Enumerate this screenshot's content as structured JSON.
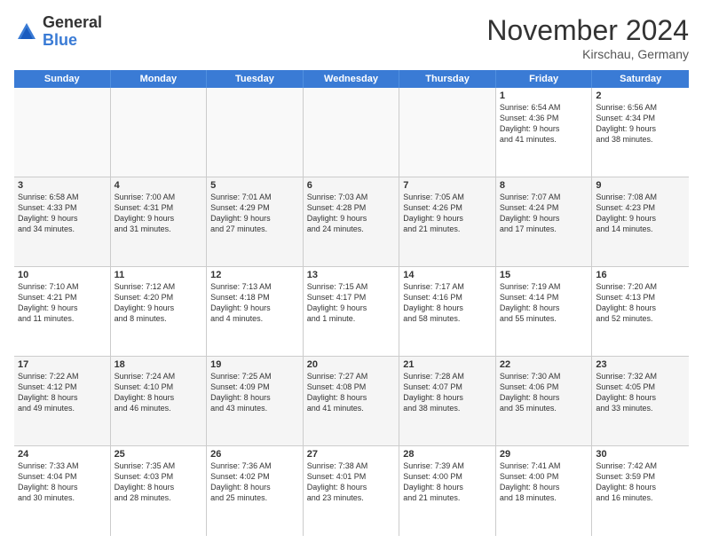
{
  "logo": {
    "general": "General",
    "blue": "Blue"
  },
  "header": {
    "month": "November 2024",
    "location": "Kirschau, Germany"
  },
  "weekdays": [
    "Sunday",
    "Monday",
    "Tuesday",
    "Wednesday",
    "Thursday",
    "Friday",
    "Saturday"
  ],
  "weeks": [
    [
      {
        "day": "",
        "info": ""
      },
      {
        "day": "",
        "info": ""
      },
      {
        "day": "",
        "info": ""
      },
      {
        "day": "",
        "info": ""
      },
      {
        "day": "",
        "info": ""
      },
      {
        "day": "1",
        "info": "Sunrise: 6:54 AM\nSunset: 4:36 PM\nDaylight: 9 hours\nand 41 minutes."
      },
      {
        "day": "2",
        "info": "Sunrise: 6:56 AM\nSunset: 4:34 PM\nDaylight: 9 hours\nand 38 minutes."
      }
    ],
    [
      {
        "day": "3",
        "info": "Sunrise: 6:58 AM\nSunset: 4:33 PM\nDaylight: 9 hours\nand 34 minutes."
      },
      {
        "day": "4",
        "info": "Sunrise: 7:00 AM\nSunset: 4:31 PM\nDaylight: 9 hours\nand 31 minutes."
      },
      {
        "day": "5",
        "info": "Sunrise: 7:01 AM\nSunset: 4:29 PM\nDaylight: 9 hours\nand 27 minutes."
      },
      {
        "day": "6",
        "info": "Sunrise: 7:03 AM\nSunset: 4:28 PM\nDaylight: 9 hours\nand 24 minutes."
      },
      {
        "day": "7",
        "info": "Sunrise: 7:05 AM\nSunset: 4:26 PM\nDaylight: 9 hours\nand 21 minutes."
      },
      {
        "day": "8",
        "info": "Sunrise: 7:07 AM\nSunset: 4:24 PM\nDaylight: 9 hours\nand 17 minutes."
      },
      {
        "day": "9",
        "info": "Sunrise: 7:08 AM\nSunset: 4:23 PM\nDaylight: 9 hours\nand 14 minutes."
      }
    ],
    [
      {
        "day": "10",
        "info": "Sunrise: 7:10 AM\nSunset: 4:21 PM\nDaylight: 9 hours\nand 11 minutes."
      },
      {
        "day": "11",
        "info": "Sunrise: 7:12 AM\nSunset: 4:20 PM\nDaylight: 9 hours\nand 8 minutes."
      },
      {
        "day": "12",
        "info": "Sunrise: 7:13 AM\nSunset: 4:18 PM\nDaylight: 9 hours\nand 4 minutes."
      },
      {
        "day": "13",
        "info": "Sunrise: 7:15 AM\nSunset: 4:17 PM\nDaylight: 9 hours\nand 1 minute."
      },
      {
        "day": "14",
        "info": "Sunrise: 7:17 AM\nSunset: 4:16 PM\nDaylight: 8 hours\nand 58 minutes."
      },
      {
        "day": "15",
        "info": "Sunrise: 7:19 AM\nSunset: 4:14 PM\nDaylight: 8 hours\nand 55 minutes."
      },
      {
        "day": "16",
        "info": "Sunrise: 7:20 AM\nSunset: 4:13 PM\nDaylight: 8 hours\nand 52 minutes."
      }
    ],
    [
      {
        "day": "17",
        "info": "Sunrise: 7:22 AM\nSunset: 4:12 PM\nDaylight: 8 hours\nand 49 minutes."
      },
      {
        "day": "18",
        "info": "Sunrise: 7:24 AM\nSunset: 4:10 PM\nDaylight: 8 hours\nand 46 minutes."
      },
      {
        "day": "19",
        "info": "Sunrise: 7:25 AM\nSunset: 4:09 PM\nDaylight: 8 hours\nand 43 minutes."
      },
      {
        "day": "20",
        "info": "Sunrise: 7:27 AM\nSunset: 4:08 PM\nDaylight: 8 hours\nand 41 minutes."
      },
      {
        "day": "21",
        "info": "Sunrise: 7:28 AM\nSunset: 4:07 PM\nDaylight: 8 hours\nand 38 minutes."
      },
      {
        "day": "22",
        "info": "Sunrise: 7:30 AM\nSunset: 4:06 PM\nDaylight: 8 hours\nand 35 minutes."
      },
      {
        "day": "23",
        "info": "Sunrise: 7:32 AM\nSunset: 4:05 PM\nDaylight: 8 hours\nand 33 minutes."
      }
    ],
    [
      {
        "day": "24",
        "info": "Sunrise: 7:33 AM\nSunset: 4:04 PM\nDaylight: 8 hours\nand 30 minutes."
      },
      {
        "day": "25",
        "info": "Sunrise: 7:35 AM\nSunset: 4:03 PM\nDaylight: 8 hours\nand 28 minutes."
      },
      {
        "day": "26",
        "info": "Sunrise: 7:36 AM\nSunset: 4:02 PM\nDaylight: 8 hours\nand 25 minutes."
      },
      {
        "day": "27",
        "info": "Sunrise: 7:38 AM\nSunset: 4:01 PM\nDaylight: 8 hours\nand 23 minutes."
      },
      {
        "day": "28",
        "info": "Sunrise: 7:39 AM\nSunset: 4:00 PM\nDaylight: 8 hours\nand 21 minutes."
      },
      {
        "day": "29",
        "info": "Sunrise: 7:41 AM\nSunset: 4:00 PM\nDaylight: 8 hours\nand 18 minutes."
      },
      {
        "day": "30",
        "info": "Sunrise: 7:42 AM\nSunset: 3:59 PM\nDaylight: 8 hours\nand 16 minutes."
      }
    ]
  ]
}
